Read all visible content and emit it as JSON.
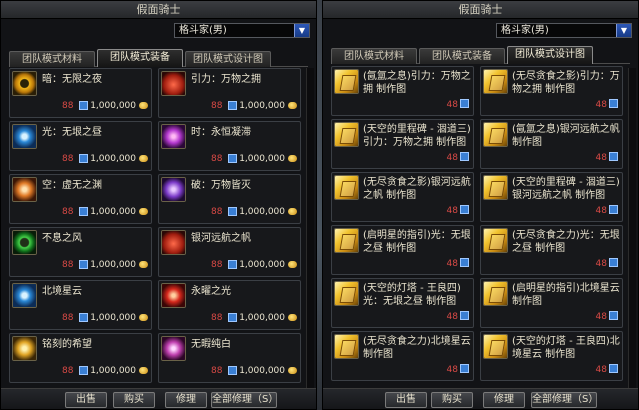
{
  "left": {
    "title": "假面骑士",
    "class_select": "格斗家(男)",
    "tabs": [
      "团队模式材料",
      "团队模式装备",
      "团队模式设计图"
    ],
    "items": [
      {
        "name": "暗：无限之夜",
        "count": "88",
        "price": "1,000,000",
        "icon": "ring-icon"
      },
      {
        "name": "引力：万物之拥",
        "count": "88",
        "price": "1,000,000",
        "icon": "heart-gem-icon"
      },
      {
        "name": "光：无垠之昼",
        "count": "88",
        "price": "1,000,000",
        "icon": "blue-ring-icon"
      },
      {
        "name": "时：永恒凝滞",
        "count": "88",
        "price": "1,000,000",
        "icon": "purple-amulet-icon"
      },
      {
        "name": "空：虚无之渊",
        "count": "88",
        "price": "1,000,000",
        "icon": "orange-amulet-icon"
      },
      {
        "name": "破：万物皆灭",
        "count": "88",
        "price": "1,000,000",
        "icon": "violet-amulet-icon"
      },
      {
        "name": "不息之风",
        "count": "88",
        "price": "1,000,000",
        "icon": "green-ring-icon"
      },
      {
        "name": "银河远航之帆",
        "count": "88",
        "price": "1,000,000",
        "icon": "orange-gem-icon"
      },
      {
        "name": "北境星云",
        "count": "88",
        "price": "1,000,000",
        "icon": "blue-ring-icon"
      },
      {
        "name": "永曜之光",
        "count": "88",
        "price": "1,000,000",
        "icon": "red-amulet-icon"
      },
      {
        "name": "铭刻的希望",
        "count": "88",
        "price": "1,000,000",
        "icon": "gold-amulet-icon"
      },
      {
        "name": "无暇纯白",
        "count": "88",
        "price": "1,000,000",
        "icon": "magenta-amulet-icon"
      }
    ],
    "buttons": [
      "出售",
      "购买",
      "修理",
      "全部修理（S）"
    ]
  },
  "right": {
    "title": "假面骑士",
    "class_select": "格斗家(男)",
    "tabs": [
      "团队模式材料",
      "团队模式装备",
      "团队模式设计图"
    ],
    "items": [
      {
        "name": "(氤氲之息)引力：万物之拥 制作图",
        "count": "48"
      },
      {
        "name": "(无尽贪食之影)引力：万物之拥 制作图",
        "count": "48"
      },
      {
        "name": "(天空的里程碑 - 涸道三)引力：万物之拥 制作图",
        "count": "48"
      },
      {
        "name": "(氤氲之息)银河远航之帆 制作图",
        "count": "48"
      },
      {
        "name": "(无尽贪食之影)银河远航之帆 制作图",
        "count": "48"
      },
      {
        "name": "(天空的里程碑 - 涸道三)银河远航之帆 制作图",
        "count": "48"
      },
      {
        "name": "(启明星的指引)光：无垠之昼 制作图",
        "count": "48"
      },
      {
        "name": "(无尽贪食之力)光：无垠之昼 制作图",
        "count": "48"
      },
      {
        "name": "(天空的灯塔 - 王良四)光：无垠之昼 制作图",
        "count": "48"
      },
      {
        "name": "(启明星的指引)北境星云 制作图",
        "count": "48"
      },
      {
        "name": "(无尽贪食之力)北境星云 制作图",
        "count": "48"
      },
      {
        "name": "(天空的灯塔 - 王良四)北境星云 制作图",
        "count": "48"
      }
    ],
    "buttons": [
      "出售",
      "购买",
      "修理",
      "全部修理（S）"
    ]
  }
}
